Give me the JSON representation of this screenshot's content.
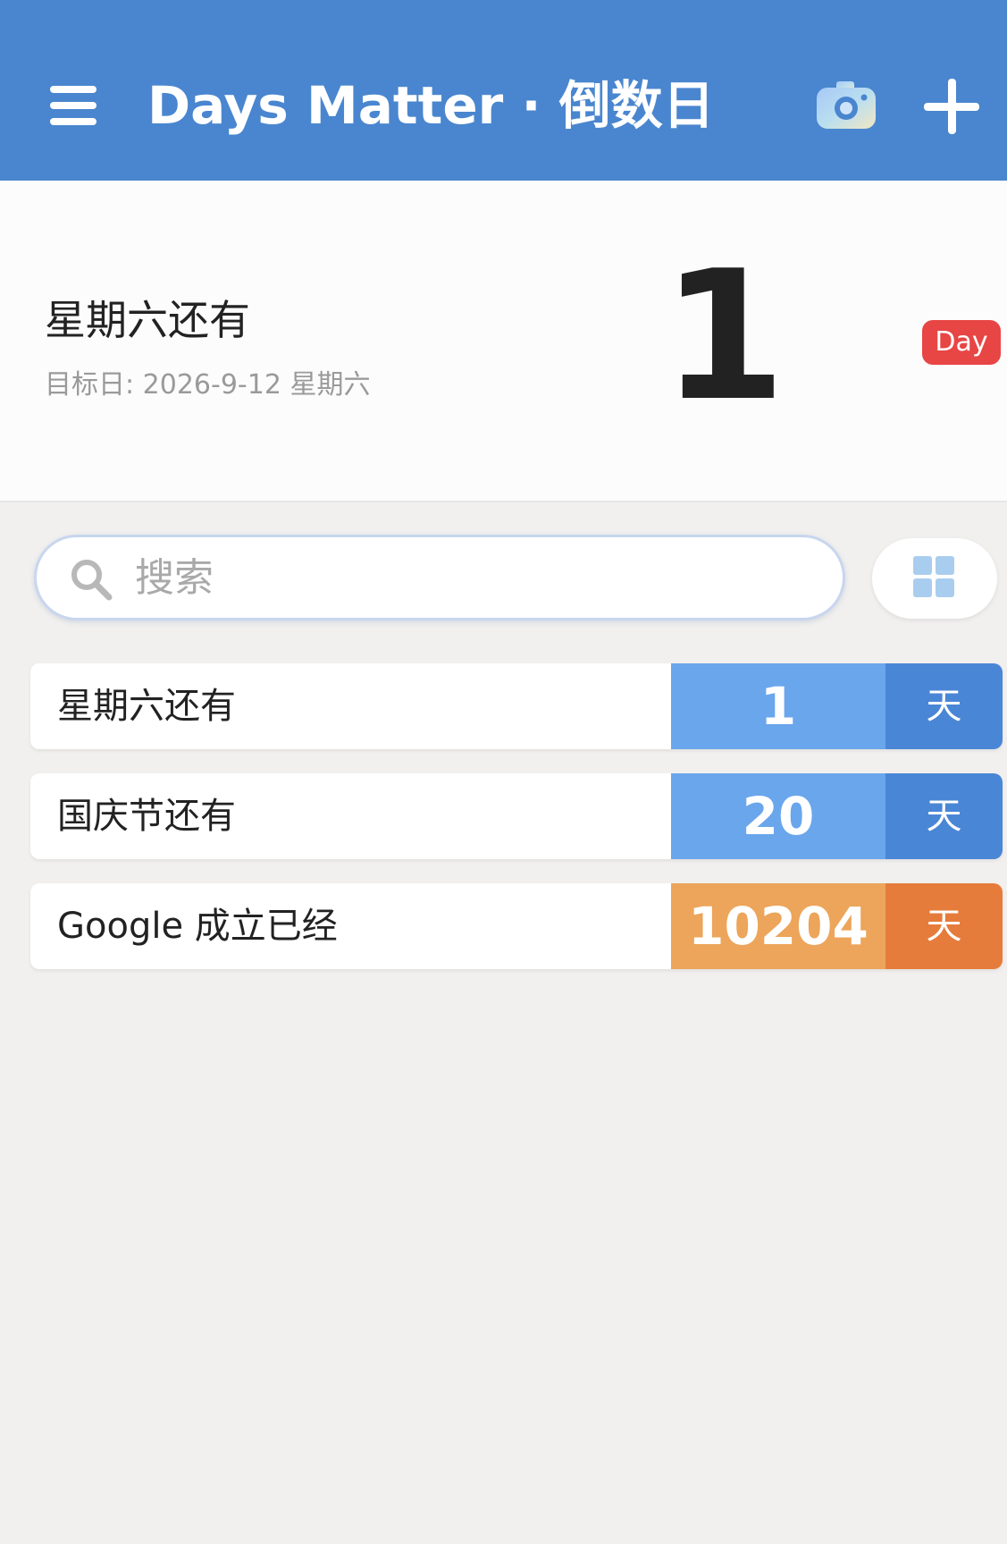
{
  "header": {
    "title": "Days Matter · 倒数日",
    "bg_color": "#4a86cf"
  },
  "icons": {
    "menu": "menu-icon",
    "camera": "camera-icon",
    "add": "plus-icon",
    "search": "search-icon",
    "grid": "grid-icon"
  },
  "featured": {
    "title": "星期六还有",
    "date_line": "目标日: 2026-9-12 星期六",
    "count": "1",
    "badge": "Day",
    "badge_color": "#e84545"
  },
  "search": {
    "placeholder": "搜索"
  },
  "events": [
    {
      "title": "星期六还有",
      "count": "1",
      "unit": "天",
      "count_color": "#6aa6ec",
      "unit_color": "#4a86d6"
    },
    {
      "title": "国庆节还有",
      "count": "20",
      "unit": "天",
      "count_color": "#6aa6ec",
      "unit_color": "#4a86d6"
    },
    {
      "title": "Google 成立已经",
      "count": "10204",
      "unit": "天",
      "count_color": "#eca55a",
      "unit_color": "#e67c3b"
    }
  ]
}
